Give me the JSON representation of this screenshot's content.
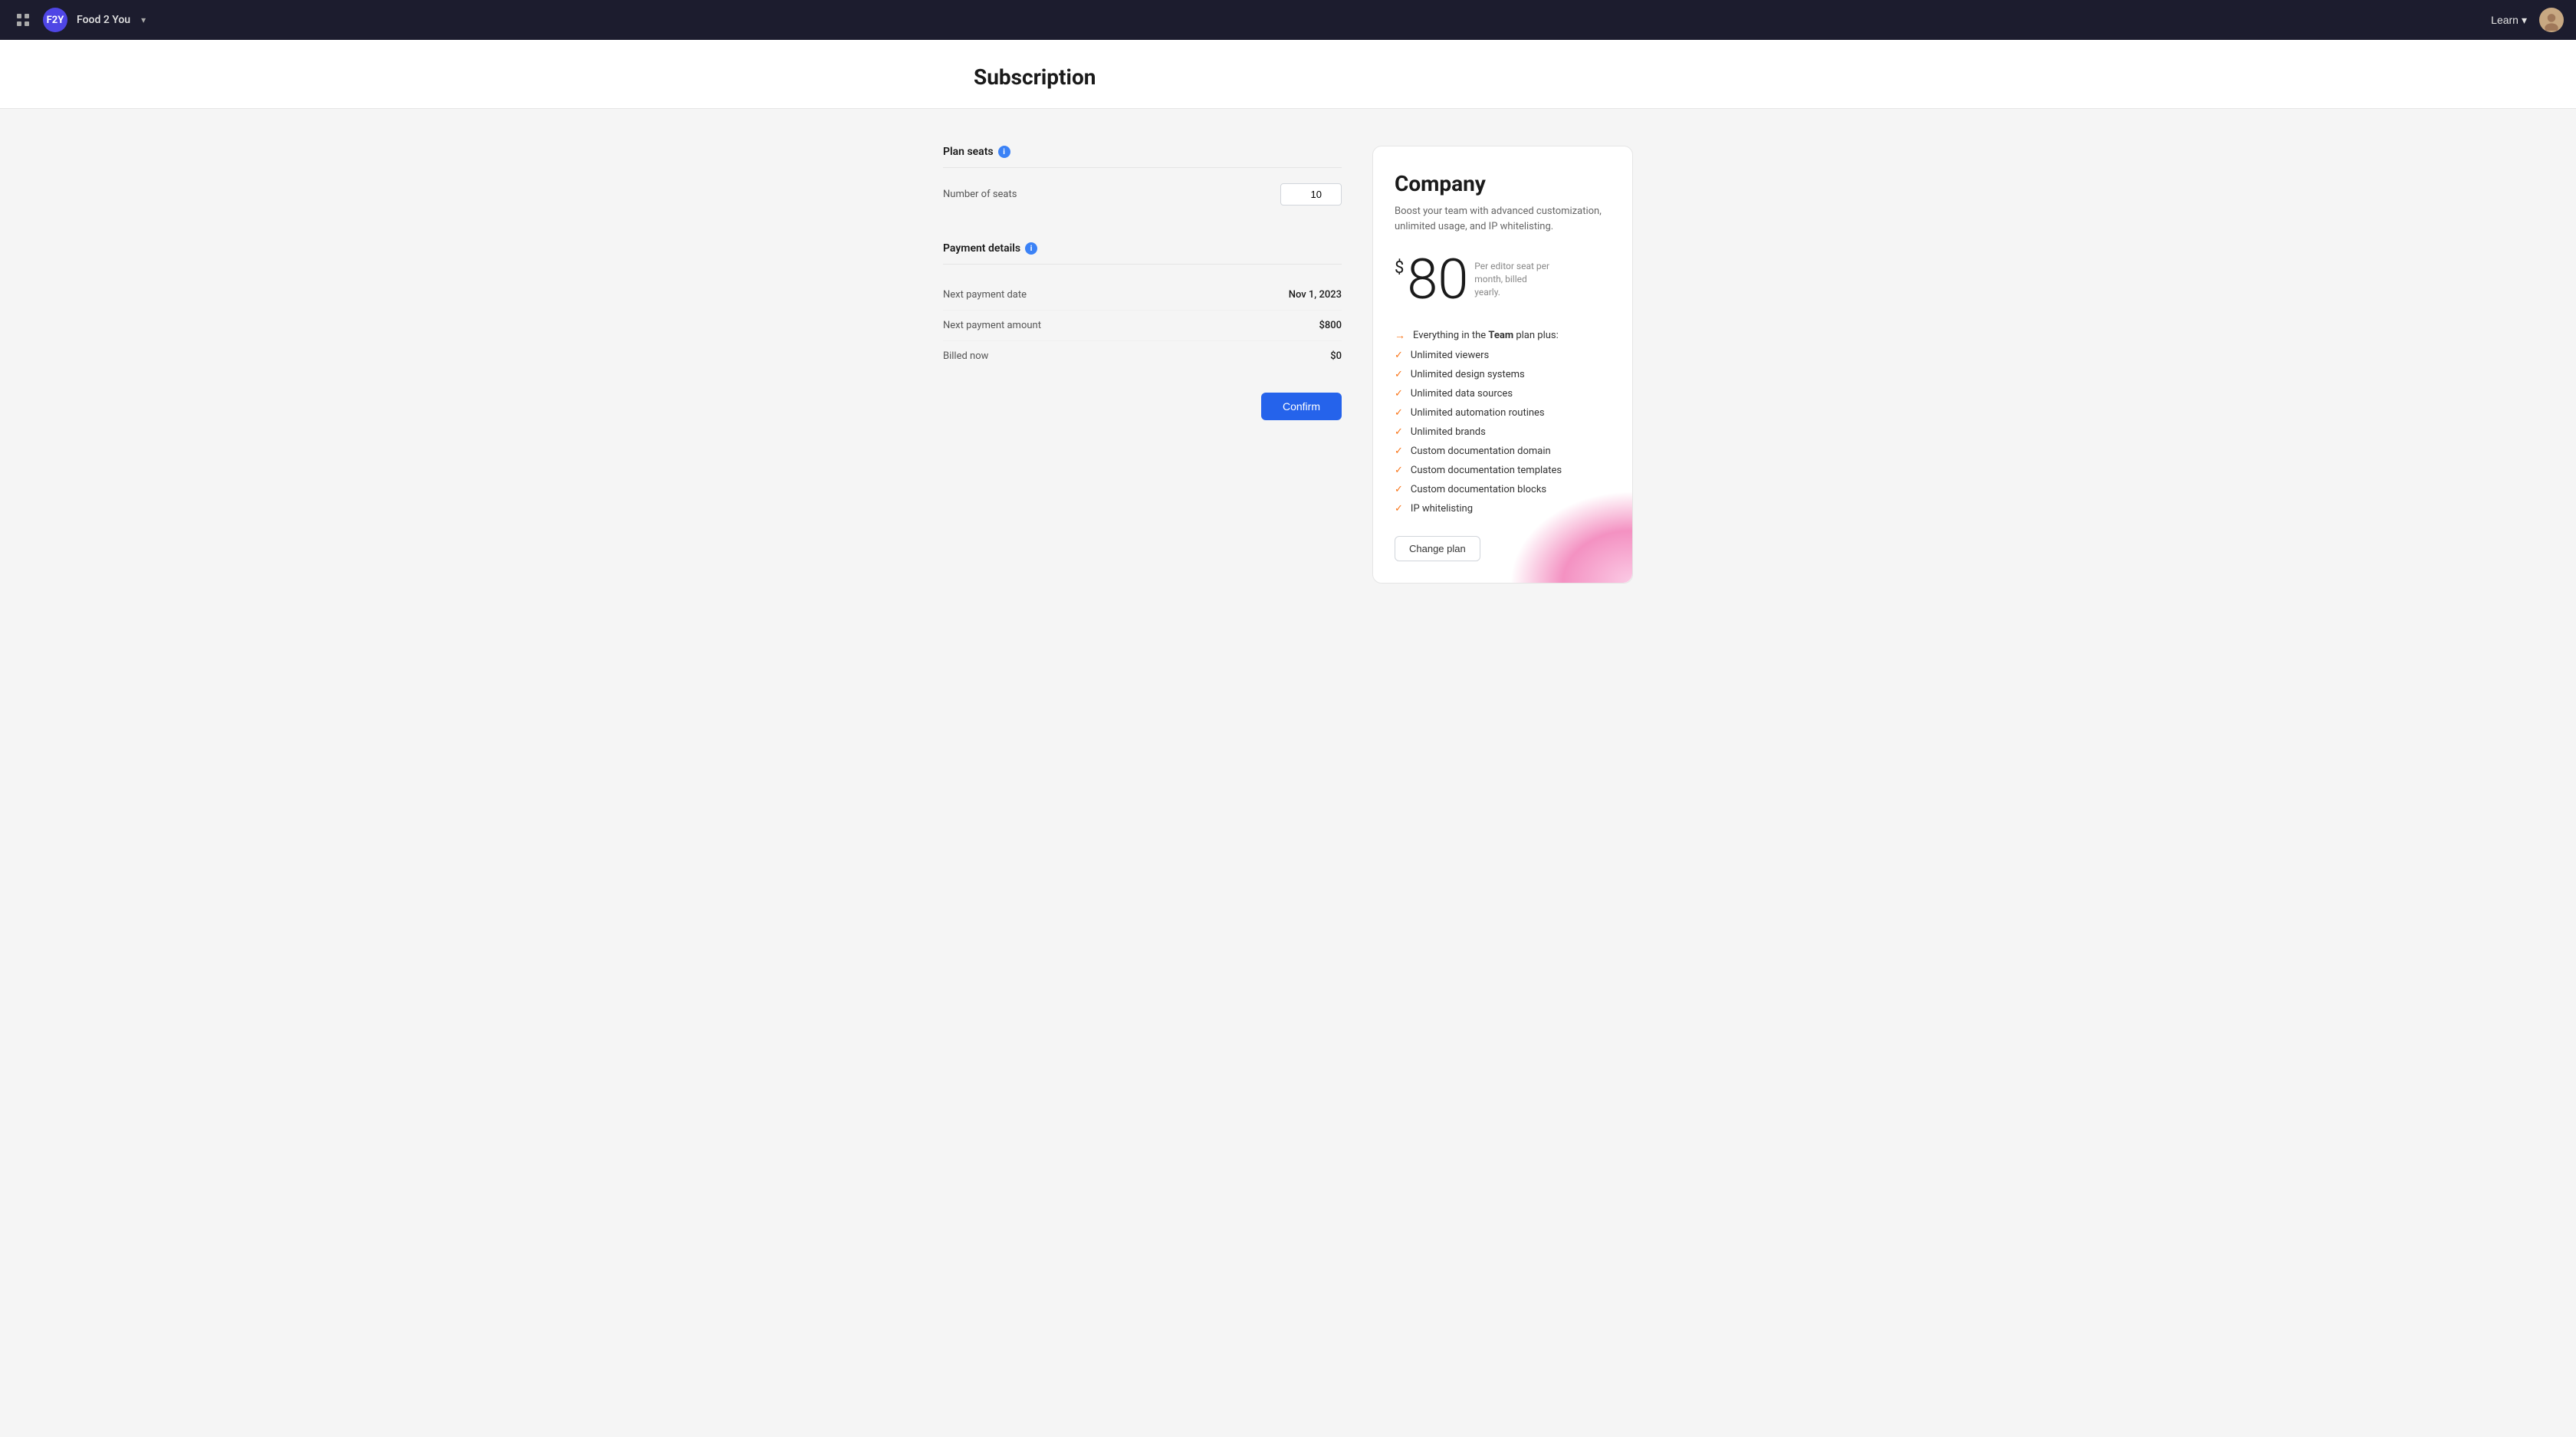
{
  "navbar": {
    "grid_icon": "grid-icon",
    "workspace_initials": "F2Y",
    "workspace_name": "Food 2 You",
    "chevron": "▾",
    "learn_label": "Learn",
    "chevron_learn": "▾"
  },
  "page": {
    "title": "Subscription"
  },
  "form": {
    "plan_seats_label": "Plan seats",
    "number_of_seats_label": "Number of seats",
    "seats_value": "10",
    "payment_details_label": "Payment details",
    "next_payment_date_label": "Next payment date",
    "next_payment_date_value": "Nov 1, 2023",
    "next_payment_amount_label": "Next payment amount",
    "next_payment_amount_value": "$800",
    "billed_now_label": "Billed now",
    "billed_now_value": "$0",
    "confirm_label": "Confirm"
  },
  "plan_card": {
    "name": "Company",
    "tagline": "Boost your team with advanced customization, unlimited usage, and IP whitelisting.",
    "price_dollar": "$",
    "price_amount": "80",
    "price_meta": "Per editor seat per month, billed yearly.",
    "features": [
      {
        "type": "arrow",
        "text_prefix": "Everything in the ",
        "text_bold": "Team",
        "text_suffix": " plan plus:"
      },
      {
        "type": "check",
        "text": "Unlimited viewers"
      },
      {
        "type": "check",
        "text": "Unlimited design systems"
      },
      {
        "type": "check",
        "text": "Unlimited data sources"
      },
      {
        "type": "check",
        "text": "Unlimited automation routines"
      },
      {
        "type": "check",
        "text": "Unlimited brands"
      },
      {
        "type": "check",
        "text": "Custom documentation domain"
      },
      {
        "type": "check",
        "text": "Custom documentation templates"
      },
      {
        "type": "check",
        "text": "Custom documentation blocks"
      },
      {
        "type": "check",
        "text": "IP whitelisting"
      }
    ],
    "change_plan_label": "Change plan"
  }
}
